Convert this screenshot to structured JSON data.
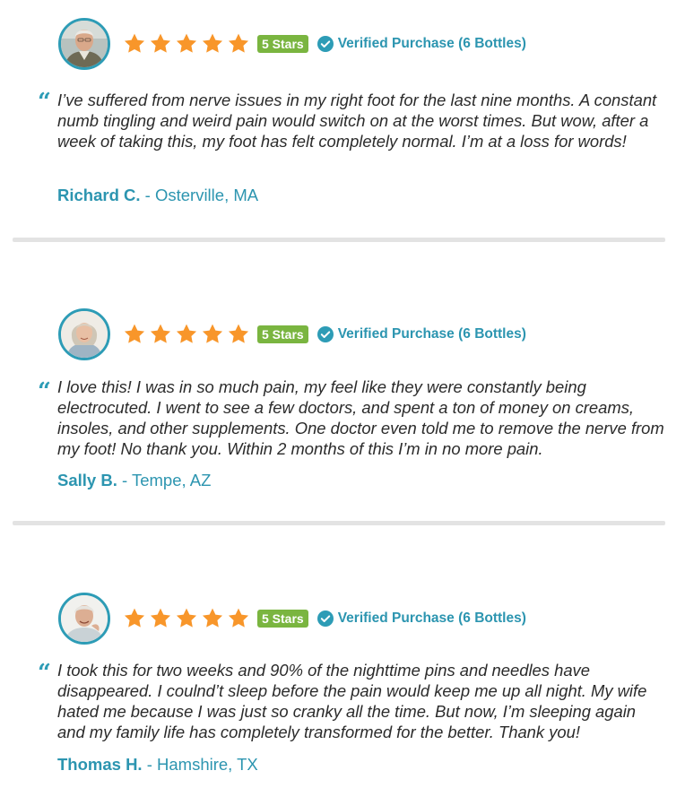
{
  "colors": {
    "accent": "#2d9cb6",
    "star": "#f8962a",
    "badge": "#7ab540",
    "divider": "#e3e3e3",
    "text": "#2b2b2b"
  },
  "icons": {
    "star": "star-icon",
    "verified": "check-circle-icon",
    "quote": "quote-icon"
  },
  "reviews": [
    {
      "rating": 5,
      "badge": "5 Stars",
      "verified": "Verified Purchase (6 Bottles)",
      "text": "I’ve suffered from nerve issues in my right foot for the last nine months. A constant numb tingling and weird pain would switch on at the worst times. But wow, after a week of taking this, my foot has felt completely normal. I’m at a loss for words!",
      "name": "Richard C.",
      "location": "- Osterville, MA"
    },
    {
      "rating": 5,
      "badge": "5 Stars",
      "verified": "Verified Purchase (6 Bottles)",
      "text": "I love this! I was in so much pain, my feel like they were constantly being electrocuted. I went to see a few doctors, and spent a ton of money on creams, insoles, and other supplements. One doctor even told me to remove the nerve from my foot! No thank you. Within 2 months of this I’m in no more pain.",
      "name": "Sally B.",
      "location": "- Tempe, AZ"
    },
    {
      "rating": 5,
      "badge": "5 Stars",
      "verified": "Verified Purchase (6 Bottles)",
      "text": "I took this for two weeks and 90% of the nighttime pins and needles have disappeared. I coulnd’t sleep before the pain would keep me up all night. My wife hated me because I was just so cranky all the time. But now, I’m sleeping again and my family life has completely transformed for the better. Thank you!",
      "name": "Thomas H.",
      "location": "- Hamshire, TX"
    }
  ]
}
